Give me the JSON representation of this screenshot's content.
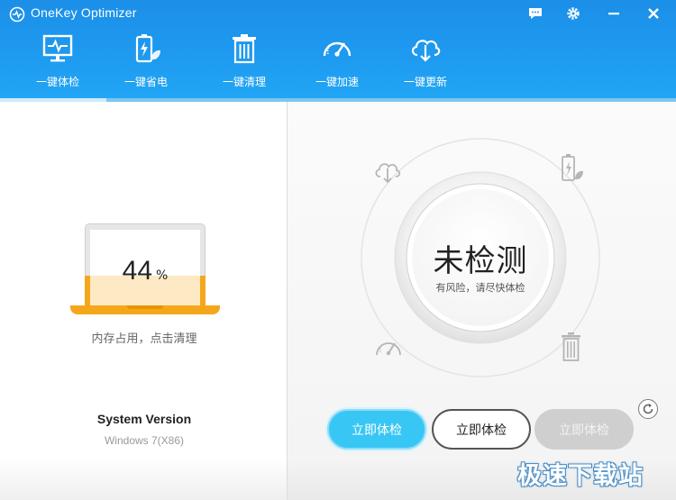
{
  "window": {
    "title": "OneKey Optimizer",
    "controls": [
      "chat-icon",
      "gear-icon",
      "minimize-icon",
      "close-icon"
    ]
  },
  "nav": {
    "items": [
      {
        "label": "一键体检",
        "icon": "monitor-heartbeat-icon",
        "active": true
      },
      {
        "label": "一键省电",
        "icon": "battery-leaf-icon",
        "active": false
      },
      {
        "label": "一键清理",
        "icon": "trash-icon",
        "active": false
      },
      {
        "label": "一键加速",
        "icon": "speedometer-icon",
        "active": false
      },
      {
        "label": "一键更新",
        "icon": "cloud-download-icon",
        "active": false
      }
    ]
  },
  "memory": {
    "percent": "44",
    "unit": "%",
    "level": 0.44,
    "caption": "内存占用，点击清理"
  },
  "system": {
    "title": "System Version",
    "value": "Windows 7(X86)"
  },
  "gauge": {
    "status": "未检测",
    "subtitle": "有风险，请尽快体检",
    "orbit_icons": [
      "cloud-download-icon",
      "battery-leaf-icon",
      "speedometer-icon",
      "trash-icon"
    ]
  },
  "buttons": {
    "primary": "立即体检",
    "outline": "立即体检",
    "disabled": "立即体检"
  },
  "watermark": "极速下载站",
  "colors": {
    "header": "#1e9bf0",
    "accent_orange": "#f5a71b",
    "primary_button": "#38c6f4"
  }
}
